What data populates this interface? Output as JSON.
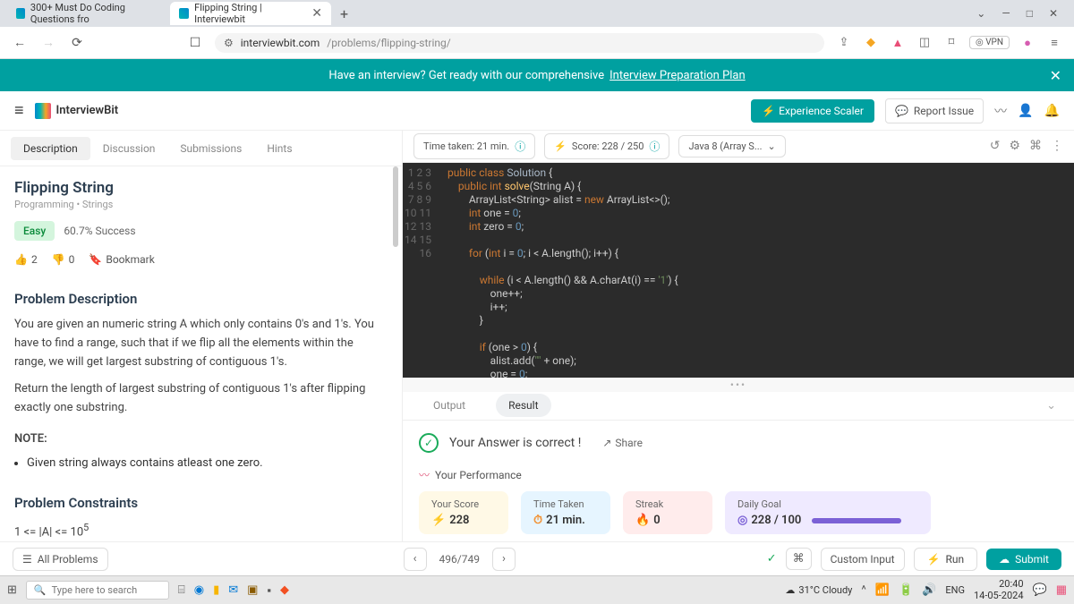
{
  "browser": {
    "tabs": [
      {
        "title": "300+ Must Do Coding Questions fro"
      },
      {
        "title": "Flipping String | Interviewbit"
      }
    ],
    "url_host": "interviewbit.com",
    "url_path": "/problems/flipping-string/",
    "vpn": "VPN",
    "window": {
      "min": "—",
      "max": "□",
      "close": "✕",
      "chev": "⌄"
    }
  },
  "banner": {
    "text": "Have an interview? Get ready with our comprehensive",
    "link": "Interview Preparation Plan"
  },
  "header": {
    "brand": "InterviewBit",
    "experience": "Experience Scaler",
    "report": "Report Issue"
  },
  "problem_tabs": [
    "Description",
    "Discussion",
    "Submissions",
    "Hints"
  ],
  "problem": {
    "title": "Flipping String",
    "crumbs": "Programming  •  Strings",
    "difficulty": "Easy",
    "success": "60.7% Success",
    "upvotes": "2",
    "downvotes": "0",
    "bookmark": "Bookmark",
    "desc_title": "Problem Description",
    "desc1": "You are given an numeric string A which only contains 0's and 1's. You have to find a range, such that if we flip all the elements within the range, we will get largest substring of contiguous 1's.",
    "desc2": "Return the length of largest substring of contiguous 1's after flipping exactly one substring.",
    "note_label": "NOTE:",
    "note_item": "Given string always contains atleast one zero.",
    "constraints_title": "Problem Constraints",
    "constraints_body": "1 <= |A| <= 10",
    "constraints_sup": "5"
  },
  "editor": {
    "time_label": "Time taken: 21 min.",
    "score_label": "Score:  228  /  250",
    "lang": "Java 8 (Array S...",
    "code": "public class Solution {\n    public int solve(String A) {\n        ArrayList<String> alist = new ArrayList<>();\n        int one = 0;\n        int zero = 0;\n\n        for (int i = 0; i < A.length(); i++) {\n\n            while (i < A.length() && A.charAt(i) == '1') {\n                one++;\n                i++;\n            }\n\n            if (one > 0) {\n                alist.add(\"\" + one);\n                one = 0;"
  },
  "result_tabs": {
    "output": "Output",
    "result": "Result"
  },
  "result": {
    "correct": "Your Answer is correct !",
    "share": "Share",
    "perf_title": "Your Performance",
    "score_label": "Your Score",
    "score_val": "228",
    "time_label": "Time Taken",
    "time_val": "21 min.",
    "streak_label": "Streak",
    "streak_val": "0",
    "goal_label": "Daily Goal",
    "goal_val": "228 / 100"
  },
  "footer": {
    "all": "All Problems",
    "count": "496/749",
    "custom": "Custom Input",
    "run": "Run",
    "submit": "Submit"
  },
  "taskbar": {
    "search": "Type here to search",
    "weather": "31°C  Cloudy",
    "lang": "ENG",
    "time": "20:40",
    "date": "14-05-2024"
  }
}
